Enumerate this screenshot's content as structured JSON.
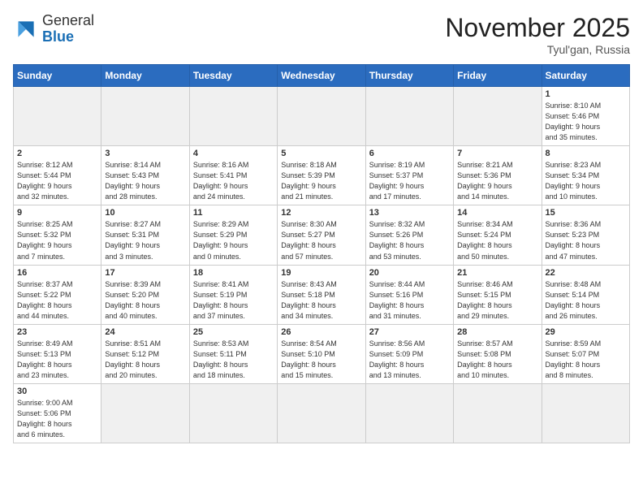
{
  "logo": {
    "general": "General",
    "blue": "Blue"
  },
  "title": "November 2025",
  "location": "Tyul'gan, Russia",
  "weekdays": [
    "Sunday",
    "Monday",
    "Tuesday",
    "Wednesday",
    "Thursday",
    "Friday",
    "Saturday"
  ],
  "days": [
    {
      "num": "",
      "info": ""
    },
    {
      "num": "",
      "info": ""
    },
    {
      "num": "",
      "info": ""
    },
    {
      "num": "",
      "info": ""
    },
    {
      "num": "",
      "info": ""
    },
    {
      "num": "",
      "info": ""
    },
    {
      "num": "1",
      "info": "Sunrise: 8:10 AM\nSunset: 5:46 PM\nDaylight: 9 hours\nand 35 minutes."
    },
    {
      "num": "2",
      "info": "Sunrise: 8:12 AM\nSunset: 5:44 PM\nDaylight: 9 hours\nand 32 minutes."
    },
    {
      "num": "3",
      "info": "Sunrise: 8:14 AM\nSunset: 5:43 PM\nDaylight: 9 hours\nand 28 minutes."
    },
    {
      "num": "4",
      "info": "Sunrise: 8:16 AM\nSunset: 5:41 PM\nDaylight: 9 hours\nand 24 minutes."
    },
    {
      "num": "5",
      "info": "Sunrise: 8:18 AM\nSunset: 5:39 PM\nDaylight: 9 hours\nand 21 minutes."
    },
    {
      "num": "6",
      "info": "Sunrise: 8:19 AM\nSunset: 5:37 PM\nDaylight: 9 hours\nand 17 minutes."
    },
    {
      "num": "7",
      "info": "Sunrise: 8:21 AM\nSunset: 5:36 PM\nDaylight: 9 hours\nand 14 minutes."
    },
    {
      "num": "8",
      "info": "Sunrise: 8:23 AM\nSunset: 5:34 PM\nDaylight: 9 hours\nand 10 minutes."
    },
    {
      "num": "9",
      "info": "Sunrise: 8:25 AM\nSunset: 5:32 PM\nDaylight: 9 hours\nand 7 minutes."
    },
    {
      "num": "10",
      "info": "Sunrise: 8:27 AM\nSunset: 5:31 PM\nDaylight: 9 hours\nand 3 minutes."
    },
    {
      "num": "11",
      "info": "Sunrise: 8:29 AM\nSunset: 5:29 PM\nDaylight: 9 hours\nand 0 minutes."
    },
    {
      "num": "12",
      "info": "Sunrise: 8:30 AM\nSunset: 5:27 PM\nDaylight: 8 hours\nand 57 minutes."
    },
    {
      "num": "13",
      "info": "Sunrise: 8:32 AM\nSunset: 5:26 PM\nDaylight: 8 hours\nand 53 minutes."
    },
    {
      "num": "14",
      "info": "Sunrise: 8:34 AM\nSunset: 5:24 PM\nDaylight: 8 hours\nand 50 minutes."
    },
    {
      "num": "15",
      "info": "Sunrise: 8:36 AM\nSunset: 5:23 PM\nDaylight: 8 hours\nand 47 minutes."
    },
    {
      "num": "16",
      "info": "Sunrise: 8:37 AM\nSunset: 5:22 PM\nDaylight: 8 hours\nand 44 minutes."
    },
    {
      "num": "17",
      "info": "Sunrise: 8:39 AM\nSunset: 5:20 PM\nDaylight: 8 hours\nand 40 minutes."
    },
    {
      "num": "18",
      "info": "Sunrise: 8:41 AM\nSunset: 5:19 PM\nDaylight: 8 hours\nand 37 minutes."
    },
    {
      "num": "19",
      "info": "Sunrise: 8:43 AM\nSunset: 5:18 PM\nDaylight: 8 hours\nand 34 minutes."
    },
    {
      "num": "20",
      "info": "Sunrise: 8:44 AM\nSunset: 5:16 PM\nDaylight: 8 hours\nand 31 minutes."
    },
    {
      "num": "21",
      "info": "Sunrise: 8:46 AM\nSunset: 5:15 PM\nDaylight: 8 hours\nand 29 minutes."
    },
    {
      "num": "22",
      "info": "Sunrise: 8:48 AM\nSunset: 5:14 PM\nDaylight: 8 hours\nand 26 minutes."
    },
    {
      "num": "23",
      "info": "Sunrise: 8:49 AM\nSunset: 5:13 PM\nDaylight: 8 hours\nand 23 minutes."
    },
    {
      "num": "24",
      "info": "Sunrise: 8:51 AM\nSunset: 5:12 PM\nDaylight: 8 hours\nand 20 minutes."
    },
    {
      "num": "25",
      "info": "Sunrise: 8:53 AM\nSunset: 5:11 PM\nDaylight: 8 hours\nand 18 minutes."
    },
    {
      "num": "26",
      "info": "Sunrise: 8:54 AM\nSunset: 5:10 PM\nDaylight: 8 hours\nand 15 minutes."
    },
    {
      "num": "27",
      "info": "Sunrise: 8:56 AM\nSunset: 5:09 PM\nDaylight: 8 hours\nand 13 minutes."
    },
    {
      "num": "28",
      "info": "Sunrise: 8:57 AM\nSunset: 5:08 PM\nDaylight: 8 hours\nand 10 minutes."
    },
    {
      "num": "29",
      "info": "Sunrise: 8:59 AM\nSunset: 5:07 PM\nDaylight: 8 hours\nand 8 minutes."
    },
    {
      "num": "30",
      "info": "Sunrise: 9:00 AM\nSunset: 5:06 PM\nDaylight: 8 hours\nand 6 minutes."
    },
    {
      "num": "",
      "info": ""
    },
    {
      "num": "",
      "info": ""
    },
    {
      "num": "",
      "info": ""
    },
    {
      "num": "",
      "info": ""
    },
    {
      "num": "",
      "info": ""
    },
    {
      "num": "",
      "info": ""
    }
  ]
}
